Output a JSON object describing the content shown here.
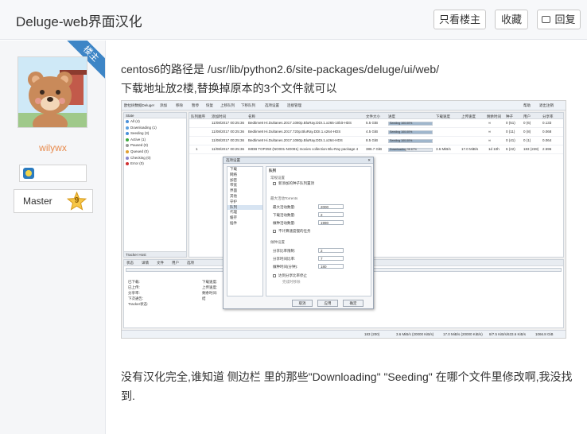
{
  "header": {
    "title": "Deluge-web界面汉化",
    "only_op_label": "只看楼主",
    "favorite_label": "收藏",
    "reply_label": "回复"
  },
  "user": {
    "ribbon": "楼主",
    "username": "wilywx",
    "rank_label": "Master",
    "level": "9"
  },
  "post": {
    "line1": "centos6的路径是 /usr/lib/python2.6/site-packages/deluge/ui/web/",
    "line2": "下载地址放2楼,替换掉原本的3个文件就可以",
    "line3": "没有汉化完全,谁知道 侧边栏 里的那些\"Downloading\" \"Seeding\" 在哪个文件里修改啊,我没找到."
  },
  "screenshot": {
    "toolbar": [
      "欧拉树数据Deluge!",
      "添加",
      "移除",
      "暂停",
      "恢复",
      "上移队列",
      "下移队列",
      "选项设置",
      "连接管理",
      "帮助",
      "退出注销"
    ],
    "sidebar_header": "State",
    "sidebar_items": [
      {
        "label": "All (4)",
        "color": "#4a90d9"
      },
      {
        "label": "Downloading (1)",
        "color": "#5aa0e0"
      },
      {
        "label": "Seeding (3)",
        "color": "#4a90d9"
      },
      {
        "label": "Active (1)",
        "color": "#3dab3d"
      },
      {
        "label": "Paused (0)",
        "color": "#999999"
      },
      {
        "label": "Queued (0)",
        "color": "#e0a030"
      },
      {
        "label": "Checking (0)",
        "color": "#8888cc"
      },
      {
        "label": "Error (0)",
        "color": "#d03030"
      }
    ],
    "sidebar_footer": "Tracker Host",
    "grid_headers": [
      "队列顺序",
      "添加时间",
      "名称",
      "文件大小",
      "进度",
      "下载速度",
      "上传速度",
      "剩余时间",
      "种子",
      "用户",
      "分享率"
    ],
    "rows": [
      {
        "q": "",
        "added": "11/08/2017 00:25:36",
        "name": "Bedtime8 Hi.Dultanes.2017.1080p.BluRay.DDI.1.x265-10bit-HDS",
        "size": "5.5 GiB",
        "progress": 1.0,
        "ptext": "Seeding 100.00%",
        "down": "",
        "up": "",
        "eta": "∞",
        "seeds": "0 (51)",
        "peers": "0 (6)",
        "ratio": "0.133"
      },
      {
        "q": "",
        "added": "11/08/2017 00:25:36",
        "name": "Bedtime8 Hi.Dultanes.2017.720p.BluRay.DDI.1.x264-HDS",
        "size": "4.5 GiB",
        "progress": 1.0,
        "ptext": "Seeding 100.00%",
        "down": "",
        "up": "",
        "eta": "∞",
        "seeds": "0 (11)",
        "peers": "0 (8)",
        "ratio": "0.068"
      },
      {
        "q": "",
        "added": "11/08/2017 00:25:36",
        "name": "Bedtime8 Hi.Dultanes.2017.1080p.BluRay.DDI.1.x264-HDS",
        "size": "8.5 GiB",
        "progress": 1.0,
        "ptext": "Seeding 100.00%",
        "down": "",
        "up": "",
        "eta": "∞",
        "seeds": "0 (41)",
        "peers": "0 (1)",
        "ratio": "0.064"
      },
      {
        "q": "1",
        "added": "11/08/2017 00:25:36",
        "name": "IMDB TOP250 (NO001-NO091) movies collection Blu-Ray package 4",
        "size": "386.7 GiB",
        "progress": 0.3667,
        "ptext": "Downloading 36.67%",
        "down": "3.6 MiB/s",
        "up": "17.0 MiB/s",
        "eta": "1d 10h",
        "seeds": "6 (22)",
        "peers": "183 (228)",
        "ratio": "2.596"
      }
    ],
    "detail_tabs": [
      "状态",
      "详情",
      "文件",
      "用户",
      "选项"
    ],
    "detail_fields": [
      "已下载:",
      "已上传:",
      "分享率:",
      "下次通告:",
      "Tracker状态:",
      "下载速度:",
      "上传速度:",
      "剩余时间:",
      "结"
    ],
    "status_bar": [
      "183 (200)",
      "3.6 MiB/s (20000 KiB/s)",
      "17.0 MiB/s (20000 KiB/s)",
      "8/7.5 KiB/s/633.6 KiB/s",
      "1066.8 GiB"
    ],
    "dialog": {
      "title": "选项设置",
      "categories": [
        "下载",
        "网络",
        "加密",
        "带宽",
        "界面",
        "其他",
        "守护",
        "队列",
        "代理",
        "缓存",
        "插件"
      ],
      "selected_category": "队列",
      "pane_title": "队列",
      "general_header": "常规设置",
      "queue_new_label": "新添加的种子队列置顶",
      "active_header": "最大活动Torrents",
      "total_active_label": "最大活动数量:",
      "total_active_value": "2000",
      "downloading_label": "下载活动数量:",
      "downloading_value": "2",
      "seeding_label": "做种活动数量:",
      "seeding_value": "1990",
      "slow_label": "不计算速度慢的任务",
      "seeding_header": "做种设置",
      "share_ratio_label": "分享比率限制:",
      "share_ratio_value": "2",
      "seed_time_ratio_label": "分享时间比率:",
      "seed_time_ratio_value": "7",
      "seed_time_label": "做种时间(分钟):",
      "seed_time_value": "180",
      "stop_label": "达到分享比率停止",
      "remove_label": "完成时移除",
      "cancel_label": "取消",
      "apply_label": "应用",
      "ok_label": "确定"
    }
  }
}
